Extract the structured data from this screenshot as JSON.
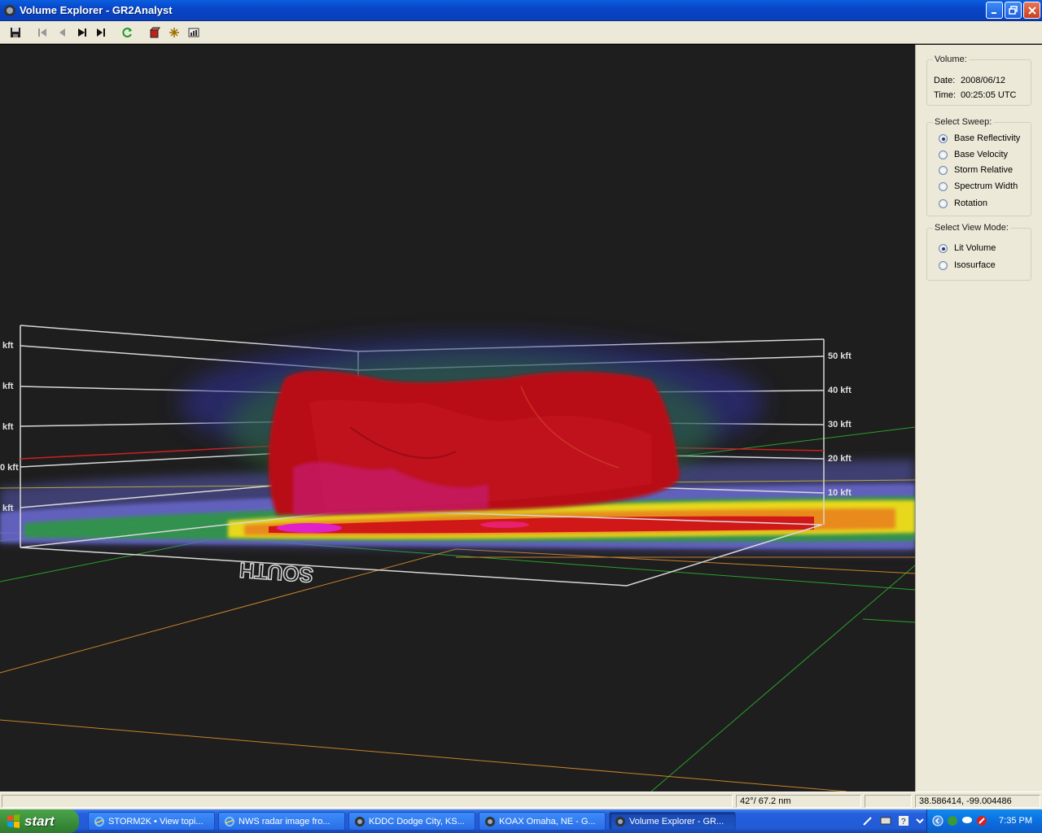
{
  "window": {
    "title": "Volume Explorer - GR2Analyst"
  },
  "toolbar": {
    "buttons": [
      "save-icon",
      "first-frame-icon",
      "previous-frame-icon",
      "play-icon",
      "last-frame-icon",
      "refresh-icon",
      "volume-cube-icon",
      "settings-star-icon",
      "chart-icon"
    ]
  },
  "viewport": {
    "left_altitude_labels": [
      "kft",
      "kft",
      "kft",
      "0 kft",
      "kft"
    ],
    "right_altitude_labels": [
      "50 kft",
      "40 kft",
      "30 kft",
      "20 kft",
      "10 kft"
    ],
    "orientation_label_south": "SOUTH",
    "colors": {
      "background": "#1e1e1e",
      "storm_core": "#b80d14",
      "county_lines": "#c8822a",
      "state_lines": "#2aa02a",
      "box_lines": "#d8d8d8"
    }
  },
  "panel": {
    "volume_group": {
      "legend": "Volume:",
      "date_label": "Date:",
      "date_value": "2008/06/12",
      "time_label": "Time:",
      "time_value": "00:25:05 UTC"
    },
    "sweep_group": {
      "legend": "Select Sweep:",
      "options": [
        {
          "label": "Base Reflectivity",
          "selected": true
        },
        {
          "label": "Base Velocity",
          "selected": false
        },
        {
          "label": "Storm Relative",
          "selected": false
        },
        {
          "label": "Spectrum Width",
          "selected": false
        },
        {
          "label": "Rotation",
          "selected": false
        }
      ]
    },
    "view_mode_group": {
      "legend": "Select View Mode:",
      "options": [
        {
          "label": "Lit Volume",
          "selected": true
        },
        {
          "label": "Isosurface",
          "selected": false
        }
      ]
    }
  },
  "statusbar": {
    "field1": "",
    "field2": "42°/ 67.2 nm",
    "field3": "",
    "field4": "38.586414, -99.004486"
  },
  "taskbar": {
    "start_label": "start",
    "tasks": [
      {
        "label": "STORM2K • View topi...",
        "active": false
      },
      {
        "label": "NWS radar image fro...",
        "active": false
      },
      {
        "label": "KDDC Dodge City, KS...",
        "active": false
      },
      {
        "label": "KOAX Omaha, NE - G...",
        "active": false
      },
      {
        "label": "Volume Explorer - GR...",
        "active": true
      }
    ],
    "clock": "7:35 PM"
  }
}
